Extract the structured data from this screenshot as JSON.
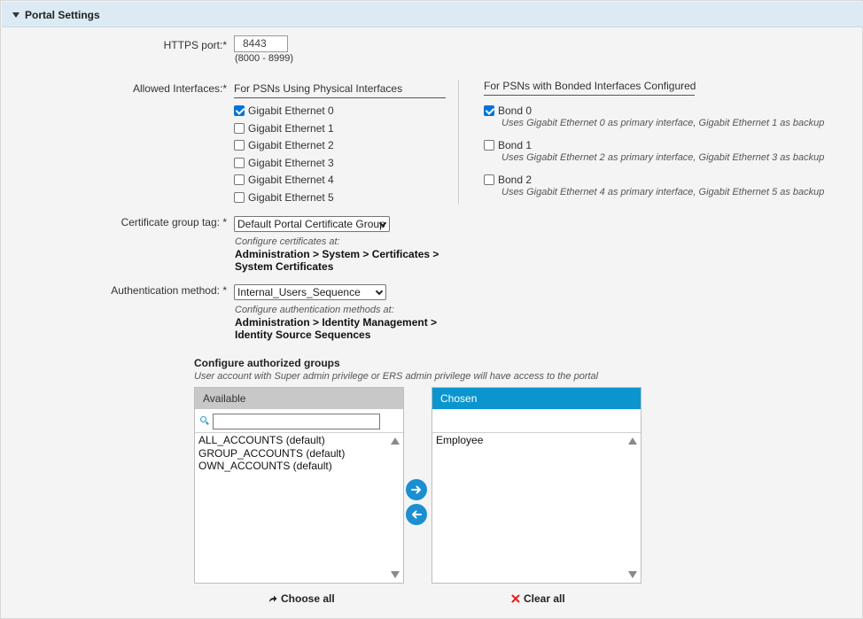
{
  "section": {
    "title": "Portal Settings"
  },
  "https_port": {
    "label": "HTTPS port:*",
    "value": "8443",
    "range_hint": "(8000 - 8999)"
  },
  "allowed_interfaces": {
    "label": "Allowed Interfaces:*",
    "physical": {
      "heading": "For PSNs Using Physical Interfaces",
      "items": [
        {
          "label": "Gigabit Ethernet 0",
          "checked": true
        },
        {
          "label": "Gigabit Ethernet 1",
          "checked": false
        },
        {
          "label": "Gigabit Ethernet 2",
          "checked": false
        },
        {
          "label": "Gigabit Ethernet 3",
          "checked": false
        },
        {
          "label": "Gigabit Ethernet 4",
          "checked": false
        },
        {
          "label": "Gigabit Ethernet 5",
          "checked": false
        }
      ]
    },
    "bonded": {
      "heading": "For PSNs with Bonded Interfaces Configured",
      "items": [
        {
          "label": "Bond 0",
          "checked": true,
          "desc": "Uses Gigabit Ethernet 0 as primary interface, Gigabit Ethernet 1 as backup"
        },
        {
          "label": "Bond 1",
          "checked": false,
          "desc": "Uses Gigabit Ethernet 2 as primary interface, Gigabit Ethernet 3 as backup"
        },
        {
          "label": "Bond 2",
          "checked": false,
          "desc": "Uses Gigabit Ethernet 4 as primary interface, Gigabit Ethernet 5 as backup"
        }
      ]
    }
  },
  "certificate": {
    "label": "Certificate group tag: *",
    "selected": "Default Portal Certificate Group",
    "hint": "Configure certificates at:",
    "path_line1": "Administration > System > Certificates >",
    "path_line2": "System Certificates"
  },
  "auth": {
    "label": "Authentication method: *",
    "selected": "Internal_Users_Sequence",
    "hint": "Configure authentication methods at:",
    "path_line1": "Administration > Identity Management >",
    "path_line2": "Identity Source Sequences"
  },
  "groups": {
    "title": "Configure authorized groups",
    "subtitle": "User account with Super admin privilege or ERS admin privilege will have access to the portal",
    "available": {
      "header": "Available",
      "search_value": "",
      "items": [
        "ALL_ACCOUNTS (default)",
        "GROUP_ACCOUNTS (default)",
        "OWN_ACCOUNTS (default)"
      ]
    },
    "chosen": {
      "header": "Chosen",
      "items": [
        "Employee"
      ]
    },
    "choose_all": "Choose all",
    "clear_all": "Clear all"
  },
  "colors": {
    "header_bg": "#dbeaf3",
    "accent": "#0b95cf",
    "button": "#1b8fd1",
    "clear": "#e02020"
  }
}
